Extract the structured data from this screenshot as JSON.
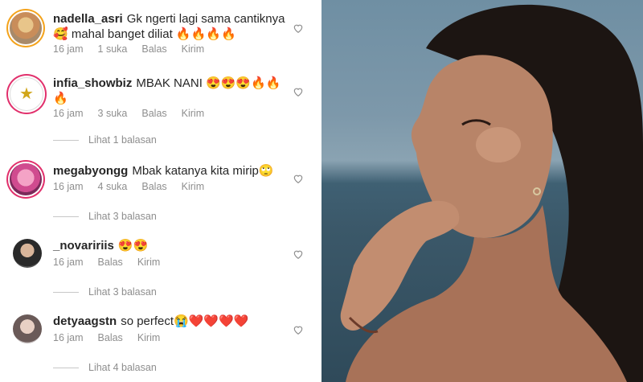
{
  "comments": [
    {
      "username": "nadella_asri",
      "text": "Gk ngerti lagi sama cantiknya 🥰 mahal banget diliat 🔥🔥🔥🔥",
      "time": "16 jam",
      "likes": "1 suka",
      "reply_label": "Balas",
      "send_label": "Kirim",
      "view_replies": ""
    },
    {
      "username": "infia_showbiz",
      "text": "MBAK NANI 😍😍😍🔥🔥🔥",
      "time": "16 jam",
      "likes": "3 suka",
      "reply_label": "Balas",
      "send_label": "Kirim",
      "view_replies": "Lihat 1 balasan"
    },
    {
      "username": "megabyongg",
      "text": "Mbak katanya kita mirip🙄",
      "time": "16 jam",
      "likes": "4 suka",
      "reply_label": "Balas",
      "send_label": "Kirim",
      "view_replies": "Lihat 3 balasan"
    },
    {
      "username": "_novaririis",
      "text": "😍😍",
      "time": "16 jam",
      "likes": "",
      "reply_label": "Balas",
      "send_label": "Kirim",
      "view_replies": "Lihat 3 balasan"
    },
    {
      "username": "detyaagstn",
      "text": "so perfect😭❤️❤️❤️❤️",
      "time": "16 jam",
      "likes": "",
      "reply_label": "Balas",
      "send_label": "Kirim",
      "view_replies": "Lihat 4 balasan"
    }
  ],
  "icons": {
    "like": "heart-outline-icon"
  }
}
